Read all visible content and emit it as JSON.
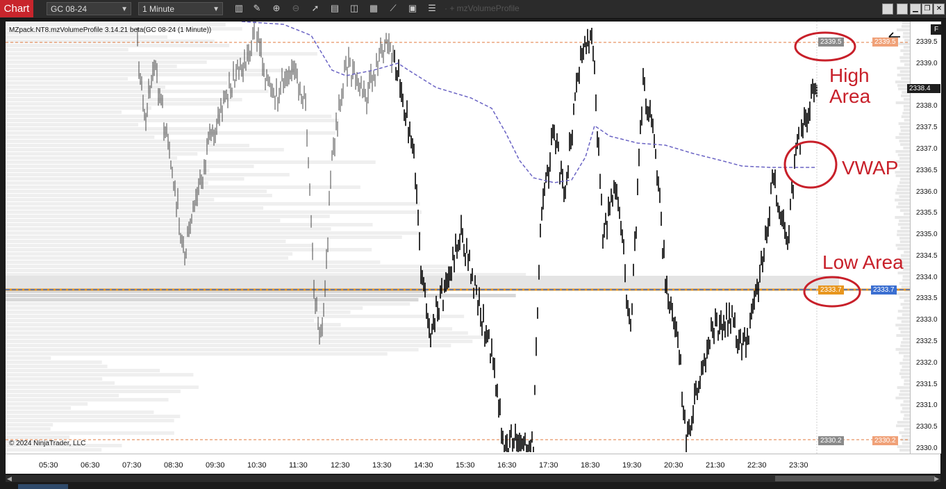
{
  "toolbar": {
    "title": "Chart",
    "instrument": "GC 08-24",
    "interval": "1 Minute",
    "indicator_ghost": "· + mzVolumeProfile"
  },
  "chart": {
    "indicator_label": "MZpack.NT8.mzVolumeProfile 3.14.21 beta(GC 08-24 (1 Minute))",
    "copyright": "© 2024 NinjaTrader, LLC",
    "y_axis_labels": [
      "2339.5",
      "2339.0",
      "2338.0",
      "2337.5",
      "2337.0",
      "2336.5",
      "2336.0",
      "2335.5",
      "2335.0",
      "2334.5",
      "2334.0",
      "2333.5",
      "2333.0",
      "2332.5",
      "2332.0",
      "2331.5",
      "2331.0",
      "2330.5",
      "2330.0"
    ],
    "x_axis_labels": [
      "05:30",
      "06:30",
      "07:30",
      "08:30",
      "09:30",
      "10:30",
      "11:30",
      "12:30",
      "13:30",
      "14:30",
      "15:30",
      "16:30",
      "17:30",
      "18:30",
      "19:30",
      "20:30",
      "21:30",
      "22:30",
      "23:30"
    ],
    "price_labels": {
      "high_left": "2339.5",
      "high_right": "2339.5",
      "last": "2338.4",
      "poc_left": "2333.7",
      "poc_right": "2333.7",
      "low_left": "2330.2",
      "low_right": "2330.2"
    },
    "annotations": {
      "high_area": "High Area",
      "vwap": "VWAP",
      "low_area": "Low Area"
    },
    "f_button": "F",
    "colors": {
      "accent": "#c8252c",
      "vwap": "#6a63c4",
      "level_line": "#e07a3e",
      "poc_fill": "#e8961e",
      "poc_blue": "#3b6fd1",
      "annotation": "#c8202a"
    }
  }
}
